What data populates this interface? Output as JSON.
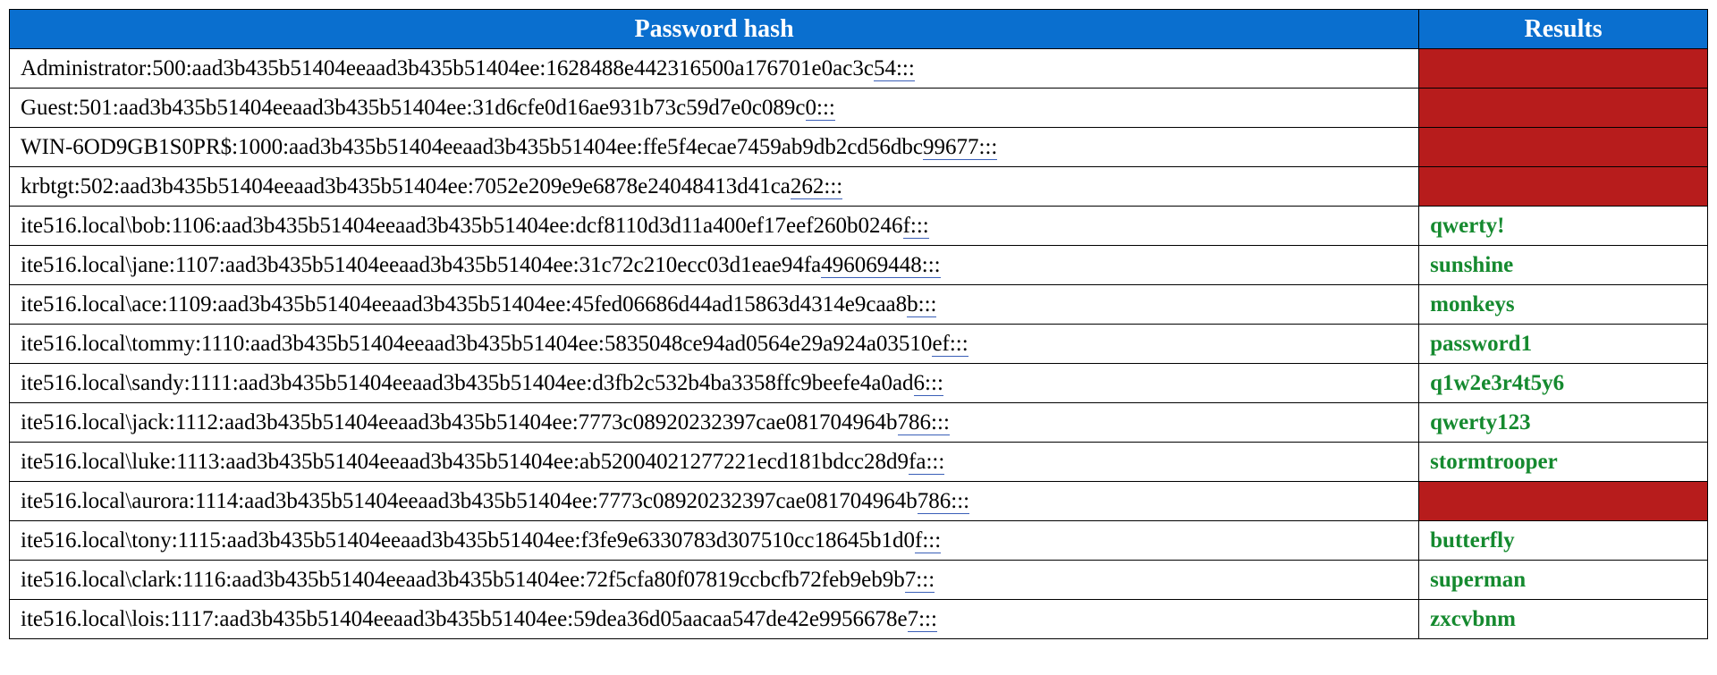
{
  "headers": {
    "hash": "Password hash",
    "results": "Results"
  },
  "rows": [
    {
      "hash_main": "Administrator:500:aad3b435b51404eeaad3b435b51404ee:1628488e442316500a176701e0ac3c",
      "hash_ul": "54:::",
      "result": "",
      "cracked": false
    },
    {
      "hash_main": "Guest:501:aad3b435b51404eeaad3b435b51404ee:31d6cfe0d16ae931b73c59d7e0c089c",
      "hash_ul": "0:::",
      "result": "",
      "cracked": false
    },
    {
      "hash_main": "WIN-6OD9GB1S0PR$:1000:aad3b435b51404eeaad3b435b51404ee:ffe5f4ecae7459ab9db2cd56dbc",
      "hash_ul": "99677:::",
      "result": "",
      "cracked": false
    },
    {
      "hash_main": "krbtgt:502:aad3b435b51404eeaad3b435b51404ee:7052e209e9e6878e24048413d41ca",
      "hash_ul": "262:::",
      "result": "",
      "cracked": false
    },
    {
      "hash_main": "ite516.local\\bob:1106:aad3b435b51404eeaad3b435b51404ee:dcf8110d3d11a400ef17eef260b0246",
      "hash_ul": "f:::",
      "result": "qwerty!",
      "cracked": true
    },
    {
      "hash_main": "ite516.local\\jane:1107:aad3b435b51404eeaad3b435b51404ee:31c72c210ecc03d1eae94fa",
      "hash_ul": "496069448:::",
      "result": "sunshine",
      "cracked": true
    },
    {
      "hash_main": "ite516.local\\ace:1109:aad3b435b51404eeaad3b435b51404ee:45fed06686d44ad15863d4314e9caa8",
      "hash_ul": "b:::",
      "result": "monkeys",
      "cracked": true
    },
    {
      "hash_main": "ite516.local\\tommy:1110:aad3b435b51404eeaad3b435b51404ee:5835048ce94ad0564e29a924a03510",
      "hash_ul": "ef:::",
      "result": "password1",
      "cracked": true
    },
    {
      "hash_main": "ite516.local\\sandy:1111:aad3b435b51404eeaad3b435b51404ee:d3fb2c532b4ba3358ffc9beefe4a0ad",
      "hash_ul": "6:::",
      "result": "q1w2e3r4t5y6",
      "cracked": true
    },
    {
      "hash_main": "ite516.local\\jack:1112:aad3b435b51404eeaad3b435b51404ee:7773c08920232397cae081704964b",
      "hash_ul": "786:::",
      "result": "qwerty123",
      "cracked": true
    },
    {
      "hash_main": "ite516.local\\luke:1113:aad3b435b51404eeaad3b435b51404ee:ab52004021277221ecd181bdcc28d9",
      "hash_ul": "fa:::",
      "result": "stormtrooper",
      "cracked": true
    },
    {
      "hash_main": "ite516.local\\aurora:1114:aad3b435b51404eeaad3b435b51404ee:7773c08920232397cae081704964b",
      "hash_ul": "786:::",
      "result": "",
      "cracked": false
    },
    {
      "hash_main": "ite516.local\\tony:1115:aad3b435b51404eeaad3b435b51404ee:f3fe9e6330783d307510cc18645b1d0",
      "hash_ul": "f:::",
      "result": "butterfly",
      "cracked": true
    },
    {
      "hash_main": "ite516.local\\clark:1116:aad3b435b51404eeaad3b435b51404ee:72f5cfa80f07819ccbcfb72feb9eb9b",
      "hash_ul": "7:::",
      "result": "superman",
      "cracked": true
    },
    {
      "hash_main": "ite516.local\\lois:1117:aad3b435b51404eeaad3b435b51404ee:59dea36d05aacaa547de42e9956678e",
      "hash_ul": "7:::",
      "result": "zxcvbnm",
      "cracked": true
    }
  ]
}
